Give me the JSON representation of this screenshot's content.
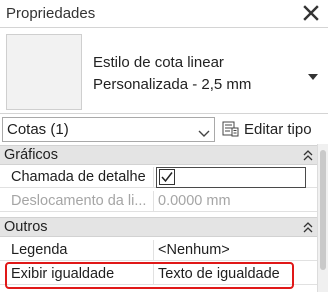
{
  "panel": {
    "title": "Propriedades",
    "close_icon": "close-icon"
  },
  "type_selector": {
    "line1": "Estilo de cota linear",
    "line2": "Personalizada - 2,5 mm"
  },
  "filter": {
    "selected": "Cotas (1)",
    "edit_type_label": "Editar tipo"
  },
  "categories": {
    "graphics": "Gráficos",
    "others": "Outros"
  },
  "properties": {
    "detail_callout": {
      "name": "Chamada de detalhe",
      "checked": true
    },
    "offset": {
      "name": "Deslocamento da li...",
      "value": "0.0000 mm"
    },
    "legend": {
      "name": "Legenda",
      "value": "<Nenhum>"
    },
    "equality": {
      "name": "Exibir igualdade",
      "value": "Texto de igualdade"
    }
  },
  "colors": {
    "highlight": "#e01818",
    "category_bg": "#e4e4e4",
    "disabled_text": "#a5a5a5"
  }
}
